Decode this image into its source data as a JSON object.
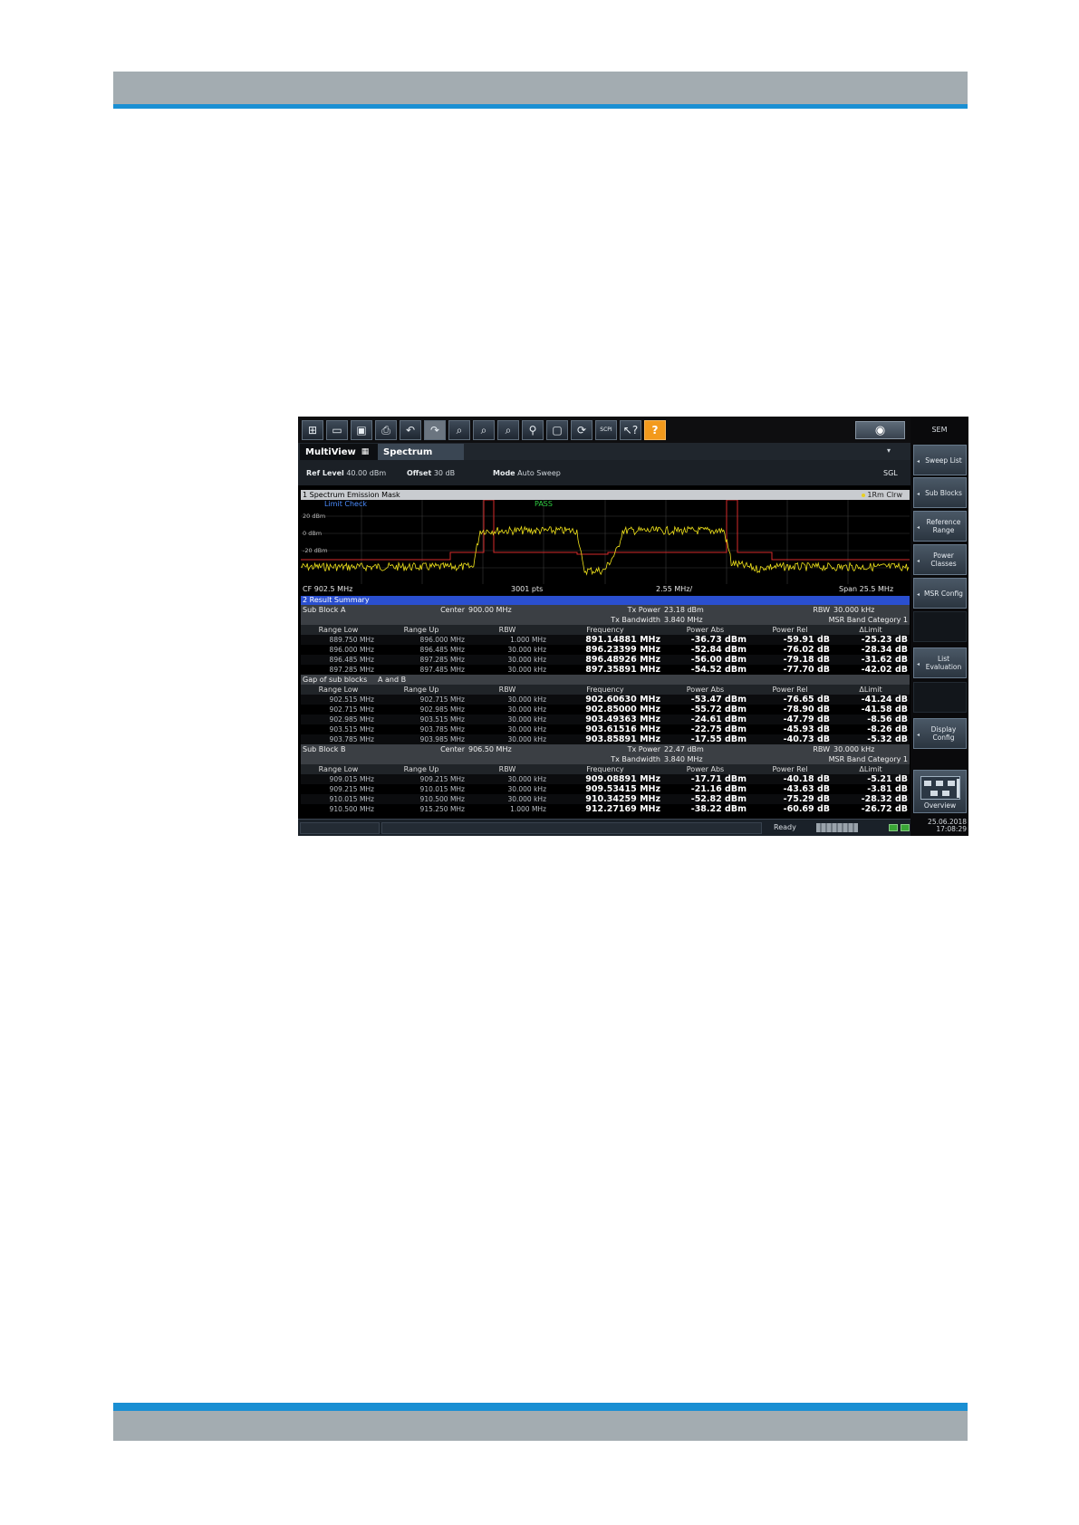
{
  "toolbar": {
    "icons": [
      "windows-icon",
      "open-folder-icon",
      "save-icon",
      "print-icon",
      "undo-icon",
      "redo-icon",
      "zoom-area-icon",
      "multi-zoom-icon",
      "zoom-off-icon",
      "zoom-1to1-icon",
      "fullscreen-icon",
      "refresh-icon",
      "scpi-icon",
      "context-help-icon",
      "help-icon"
    ],
    "scpi_label": "SCPI",
    "help_label": "?"
  },
  "softkeys": {
    "title": "SEM",
    "items": [
      {
        "label": "Sweep List"
      },
      {
        "label": "Sub Blocks"
      },
      {
        "label": "Reference Range"
      },
      {
        "label": "Power Classes"
      },
      {
        "label": "MSR Config"
      },
      {
        "label": ""
      },
      {
        "label": "List Evaluation"
      },
      {
        "label": ""
      },
      {
        "label": "Display Config"
      },
      {
        "label": "Overview"
      }
    ]
  },
  "tabs": {
    "multiview": "MultiView",
    "spectrum": "Spectrum",
    "dropdown": "▾"
  },
  "settings": {
    "ref_level_key": "Ref Level",
    "ref_level_val": "40.00 dBm",
    "offset_key": "Offset",
    "offset_val": "30 dB",
    "mode_key": "Mode",
    "mode_val": "Auto Sweep",
    "sgl": "SGL"
  },
  "diagram": {
    "title": "1 Spectrum Emission Mask",
    "trace_label": "1Rm Clrw",
    "limit_check": "Limit Check",
    "pass": "PASS",
    "y_labels": [
      "20 dBm",
      "0 dBm",
      "-20 dBm"
    ],
    "cf": "CF 902.5 MHz",
    "pts": "3001 pts",
    "div": "2.55 MHz/",
    "span": "Span 25.5 MHz"
  },
  "result_summary": {
    "title": "2 Result Summary",
    "columns": [
      "Range Low",
      "Range Up",
      "RBW",
      "Frequency",
      "Power Abs",
      "Power Rel",
      "ΔLimit"
    ],
    "sub_block_a": {
      "name": "Sub Block A",
      "center_key": "Center",
      "center_val": "900.00 MHz",
      "tx_power_key": "Tx Power",
      "tx_power_val": "23.18 dBm",
      "rbw_key": "RBW",
      "rbw_val": "30.000 kHz",
      "tx_bw_key": "Tx Bandwidth",
      "tx_bw_val": "3.840 MHz",
      "category": "MSR Band Category 1",
      "rows": [
        [
          "889.750 MHz",
          "896.000 MHz",
          "1.000 MHz",
          "891.14881 MHz",
          "-36.73 dBm",
          "-59.91 dB",
          "-25.23 dB"
        ],
        [
          "896.000 MHz",
          "896.485 MHz",
          "30.000 kHz",
          "896.23399 MHz",
          "-52.84 dBm",
          "-76.02 dB",
          "-28.34 dB"
        ],
        [
          "896.485 MHz",
          "897.285 MHz",
          "30.000 kHz",
          "896.48926 MHz",
          "-56.00 dBm",
          "-79.18 dB",
          "-31.62 dB"
        ],
        [
          "897.285 MHz",
          "897.485 MHz",
          "30.000 kHz",
          "897.35891 MHz",
          "-54.52 dBm",
          "-77.70 dB",
          "-42.02 dB"
        ]
      ]
    },
    "gap": {
      "name": "Gap of sub blocks",
      "which": "A and B",
      "rows": [
        [
          "902.515 MHz",
          "902.715 MHz",
          "30.000 kHz",
          "902.60630 MHz",
          "-53.47 dBm",
          "-76.65 dB",
          "-41.24 dB"
        ],
        [
          "902.715 MHz",
          "902.985 MHz",
          "30.000 kHz",
          "902.85000 MHz",
          "-55.72 dBm",
          "-78.90 dB",
          "-41.58 dB"
        ],
        [
          "902.985 MHz",
          "903.515 MHz",
          "30.000 kHz",
          "903.49363 MHz",
          "-24.61 dBm",
          "-47.79 dB",
          "-8.56 dB"
        ],
        [
          "903.515 MHz",
          "903.785 MHz",
          "30.000 kHz",
          "903.61516 MHz",
          "-22.75 dBm",
          "-45.93 dB",
          "-8.26 dB"
        ],
        [
          "903.785 MHz",
          "903.985 MHz",
          "30.000 kHz",
          "903.85891 MHz",
          "-17.55 dBm",
          "-40.73 dB",
          "-5.32 dB"
        ]
      ]
    },
    "sub_block_b": {
      "name": "Sub Block B",
      "center_key": "Center",
      "center_val": "906.50 MHz",
      "tx_power_key": "Tx Power",
      "tx_power_val": "22.47 dBm",
      "rbw_key": "RBW",
      "rbw_val": "30.000 kHz",
      "tx_bw_key": "Tx Bandwidth",
      "tx_bw_val": "3.840 MHz",
      "category": "MSR Band Category 1",
      "rows": [
        [
          "909.015 MHz",
          "909.215 MHz",
          "30.000 kHz",
          "909.08891 MHz",
          "-17.71 dBm",
          "-40.18 dB",
          "-5.21 dB"
        ],
        [
          "909.215 MHz",
          "910.015 MHz",
          "30.000 kHz",
          "909.53415 MHz",
          "-21.16 dBm",
          "-43.63 dB",
          "-3.81 dB"
        ],
        [
          "910.015 MHz",
          "910.500 MHz",
          "30.000 kHz",
          "910.34259 MHz",
          "-52.82 dBm",
          "-75.29 dB",
          "-28.32 dB"
        ],
        [
          "910.500 MHz",
          "915.250 MHz",
          "1.000 MHz",
          "912.27169 MHz",
          "-38.22 dBm",
          "-60.69 dB",
          "-26.72 dB"
        ]
      ]
    }
  },
  "status": {
    "ready": "Ready",
    "date": "25.06.2018",
    "time": "17:08:29"
  },
  "colors": {
    "trace": "#f0e21a",
    "limit_line": "#d42a2a",
    "pass": "#2ecc40",
    "limit_check": "#4a8cff",
    "result_title_bg": "#2a4fcf",
    "page_band": "#a3acb1",
    "page_accent": "#1a8fd3"
  }
}
